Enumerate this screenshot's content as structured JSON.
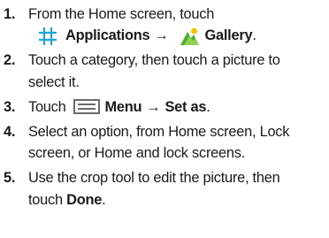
{
  "steps": [
    {
      "number": "1.",
      "line1": "From the Home screen, touch",
      "applications_label": "Applications",
      "arrow": "→",
      "gallery_label": "Gallery",
      "end_punct": "."
    },
    {
      "number": "2.",
      "text_line1": "Touch a category, then touch a picture to",
      "text_line2": "select it."
    },
    {
      "number": "3.",
      "prefix": "Touch",
      "menu_label": "Menu",
      "arrow": "→",
      "set_as_label": "Set as",
      "end_punct": "."
    },
    {
      "number": "4.",
      "text_line1": "Select an option, from Home screen, Lock",
      "text_line2": "screen, or Home and lock screens."
    },
    {
      "number": "5.",
      "text_line1": "Use the crop tool to edit the picture, then",
      "text_line2_prefix": "touch ",
      "done_label": "Done",
      "end_punct": "."
    }
  ],
  "colors": {
    "text": "#1a1a1a",
    "applications_icon": "#1ea7d6",
    "menu_icon": "#6b6b6b",
    "gallery_green": "#4cae2f",
    "gallery_yellow": "#f2c400"
  },
  "icons": {
    "applications": "applications-grid-icon",
    "gallery": "gallery-icon",
    "menu": "menu-icon"
  }
}
